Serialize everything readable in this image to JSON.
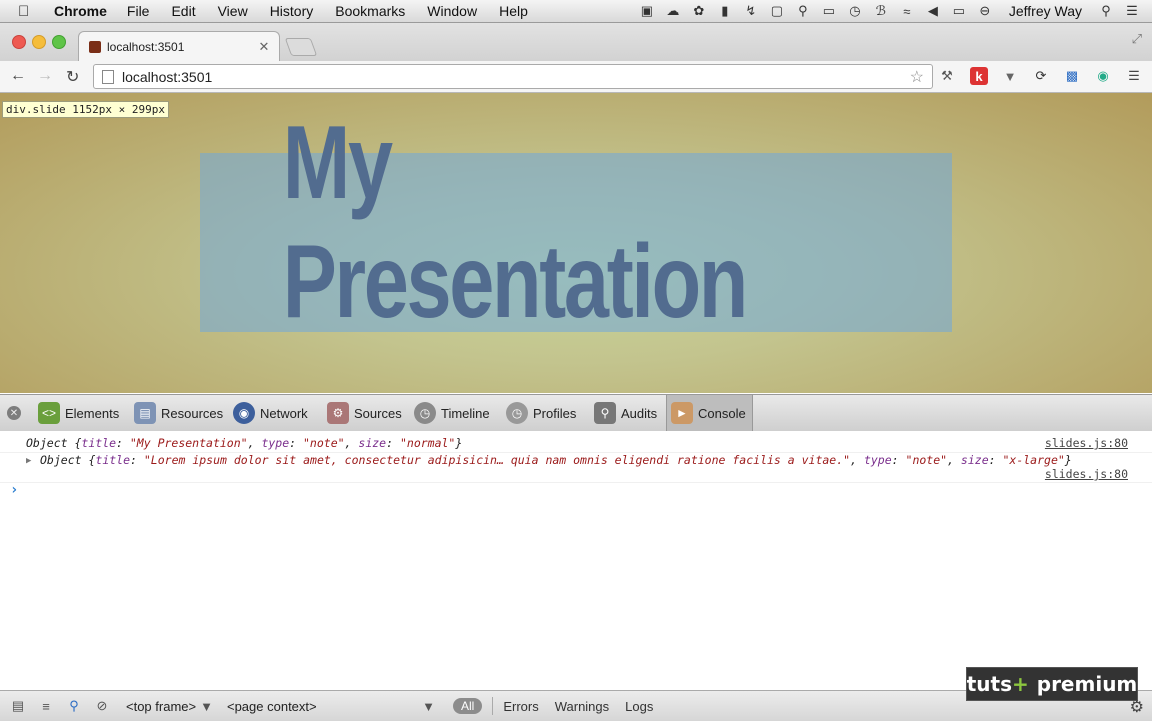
{
  "menubar": {
    "app": "Chrome",
    "items": [
      "File",
      "Edit",
      "View",
      "History",
      "Bookmarks",
      "Window",
      "Help"
    ],
    "user": "Jeffrey Way"
  },
  "tab": {
    "title": "localhost:3501"
  },
  "toolbar": {
    "url": "localhost:3501"
  },
  "page": {
    "inspect_tooltip": "div.slide 1152px × 299px",
    "slide_title": "My Presentation"
  },
  "devtools": {
    "panels": [
      "Elements",
      "Resources",
      "Network",
      "Sources",
      "Timeline",
      "Profiles",
      "Audits",
      "Console"
    ],
    "selected_panel": "Console"
  },
  "console": {
    "log1": {
      "prefix": "Object {",
      "k1": "title",
      "v1": "\"My Presentation\"",
      "k2": "type",
      "v2": "\"note\"",
      "k3": "size",
      "v3": "\"normal\"",
      "suffix": "}",
      "source": "slides.js:80"
    },
    "log2": {
      "prefix": "Object {",
      "k1": "title",
      "v1": "\"Lorem ipsum dolor sit amet, consectetur adipisicin… quia nam omnis eligendi ratione facilis a vitae.\"",
      "k2": "type",
      "v2": "\"note\"",
      "k3": "size",
      "v3": "\"x-large\"",
      "suffix": "}",
      "source": "slides.js:80"
    }
  },
  "statusbar": {
    "frame": "<top frame>",
    "context": "<page context>",
    "filters": [
      "All",
      "Errors",
      "Warnings",
      "Logs"
    ]
  },
  "brand": {
    "part1": "tuts",
    "plus": "+",
    "part2": "premium"
  }
}
